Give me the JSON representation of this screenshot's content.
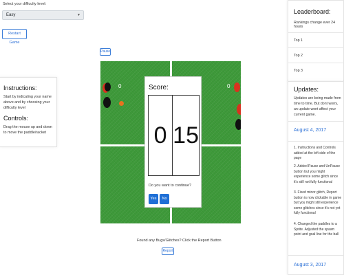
{
  "difficulty": {
    "label": "Select your difficulty level:",
    "selected": "Easy"
  },
  "buttons": {
    "restart": "Restart Game",
    "pause": "Pause",
    "report": "Report",
    "yes": "Yes",
    "no": "No"
  },
  "instructions": {
    "heading": "Instructions:",
    "text": "Start by indicating your name above and by choosing your difficulty level",
    "controls_heading": "Controls:",
    "controls_text": "Drag the mouse up and down to move the paddle/racket"
  },
  "leaderboard": {
    "heading": "Leaderboard:",
    "subtitle": "Rankings change ever 24 hours",
    "rows": [
      "Top 1",
      "Top 2",
      "Top 3"
    ]
  },
  "updates": {
    "heading": "Updates:",
    "intro": "Updates are being made from time to time. But dont worry, an update wont affect your current game.",
    "dates": [
      "August 4, 2017",
      "August 3, 2017"
    ],
    "items": [
      "1. Instructions and Controls added at the left side of the page",
      "2. Added Pause and UnPause button but you might experience some glitch since it's still not fully functional",
      "3. Fixed minor glitch, Report button is now clickable in game but you might still experience some glitches since it's not yet fully functional",
      "4. Changed the paddles to a Sprite. Adjusted the spawn point and goal line for the ball"
    ]
  },
  "game": {
    "left_score": "0",
    "right_score": "0",
    "field_color": "#3e9a3a",
    "ball_color": "#e8731f",
    "paddle_colors": [
      "#d8321f",
      "#111111"
    ]
  },
  "modal": {
    "title": "Score:",
    "player_score": "0",
    "cpu_score": "15",
    "question": "Do you want to continue?"
  },
  "footer": {
    "bugs_text": "Found any Bugs/Glitches? Click the Report Button"
  }
}
